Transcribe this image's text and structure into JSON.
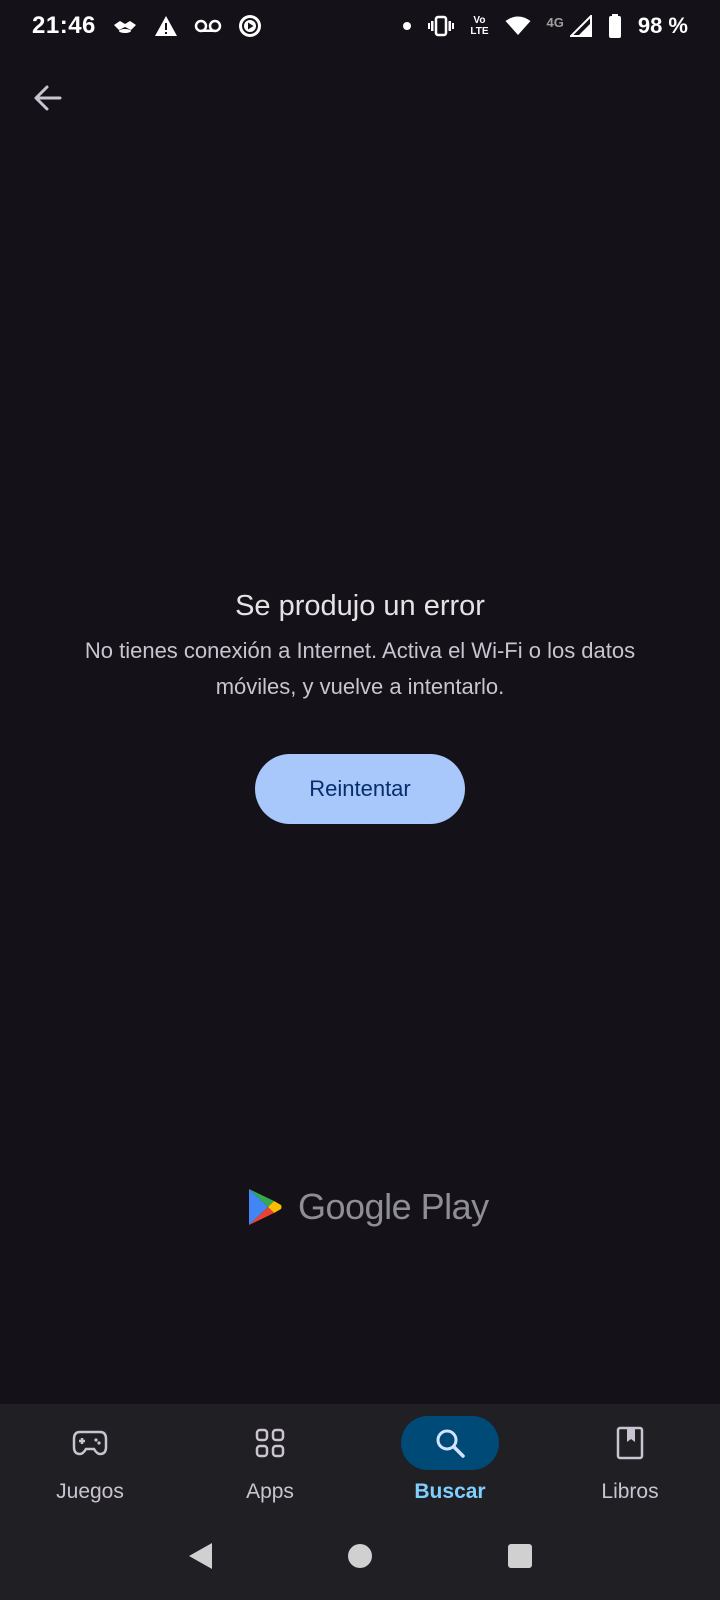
{
  "status_bar": {
    "time": "21:46",
    "left_icons": [
      "handshake-icon",
      "warning-icon",
      "voicemail-icon",
      "play-circle-icon"
    ],
    "right_icons": [
      "dot-icon",
      "vibrate-icon",
      "volte-icon",
      "wifi-icon",
      "signal-icon",
      "battery-icon"
    ],
    "volte_top": "Vo",
    "volte_bottom": "LTE",
    "network_type": "4G",
    "battery": "98 %"
  },
  "top_bar": {
    "back_icon": "arrow-back-icon"
  },
  "error": {
    "title": "Se produjo un error",
    "message": "No tienes conexión a Internet. Activa el Wi-Fi o los datos móviles, y vuelve a intentarlo.",
    "retry_label": "Reintentar"
  },
  "branding": {
    "text": "Google Play",
    "colors": {
      "blue": "#4285F4",
      "green": "#34A853",
      "yellow": "#FBBC04",
      "red": "#EA4335"
    }
  },
  "bottom_nav": {
    "items": [
      {
        "label": "Juegos",
        "icon": "gamepad-icon",
        "active": false
      },
      {
        "label": "Apps",
        "icon": "apps-grid-icon",
        "active": false
      },
      {
        "label": "Buscar",
        "icon": "search-icon",
        "active": true
      },
      {
        "label": "Libros",
        "icon": "book-icon",
        "active": false
      }
    ],
    "active_color": "#7fcfff",
    "active_pill_color": "#004a77"
  },
  "system_nav": {
    "icons": [
      "back-triangle-icon",
      "home-circle-icon",
      "recents-square-icon"
    ]
  },
  "colors": {
    "background": "#141218",
    "nav_background": "#1f1f24",
    "button": "#a8c7fa",
    "button_text": "#062e6f"
  }
}
